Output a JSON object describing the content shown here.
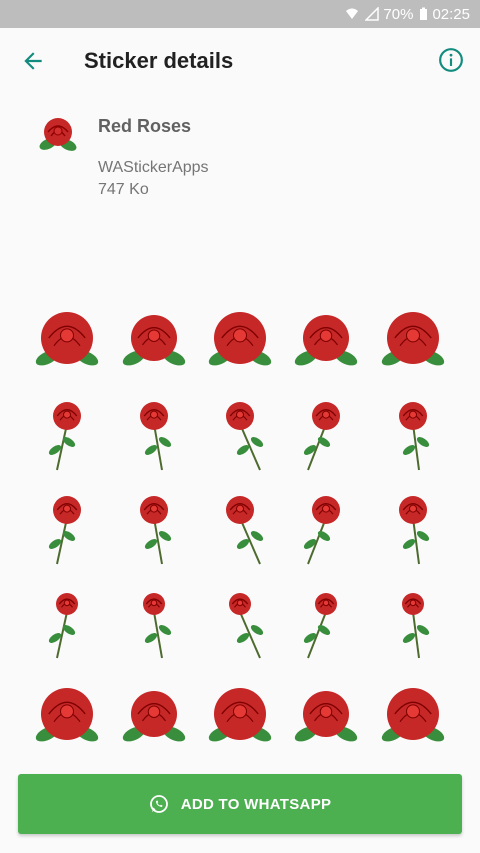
{
  "status_bar": {
    "battery": "70%",
    "time": "02:25"
  },
  "app_bar": {
    "title": "Sticker details",
    "back_icon": "arrow-back-icon",
    "info_icon": "info-icon"
  },
  "pack": {
    "name": "Red Roses",
    "publisher": "WAStickerApps",
    "size": "747 Ko",
    "tray_icon": "rose-icon"
  },
  "colors": {
    "accent": "#128c7e",
    "button": "#4caf50",
    "rose": "#c62828",
    "leaf": "#388e3c"
  },
  "stickers": [
    "rose-sticker-1",
    "rose-sticker-2",
    "rose-sticker-3",
    "rose-sticker-4",
    "rose-sticker-5",
    "rose-sticker-6",
    "rose-sticker-7",
    "rose-sticker-8",
    "rose-sticker-9",
    "rose-sticker-10",
    "rose-sticker-11",
    "rose-sticker-12",
    "rose-sticker-13",
    "rose-sticker-14",
    "rose-sticker-15",
    "rose-sticker-16",
    "rose-sticker-17",
    "rose-sticker-18",
    "rose-sticker-19",
    "rose-sticker-20",
    "rose-sticker-21",
    "rose-sticker-22",
    "rose-sticker-23",
    "rose-sticker-24",
    "rose-sticker-25"
  ],
  "add_button": {
    "label": "ADD TO WHATSAPP",
    "icon": "whatsapp-icon"
  }
}
